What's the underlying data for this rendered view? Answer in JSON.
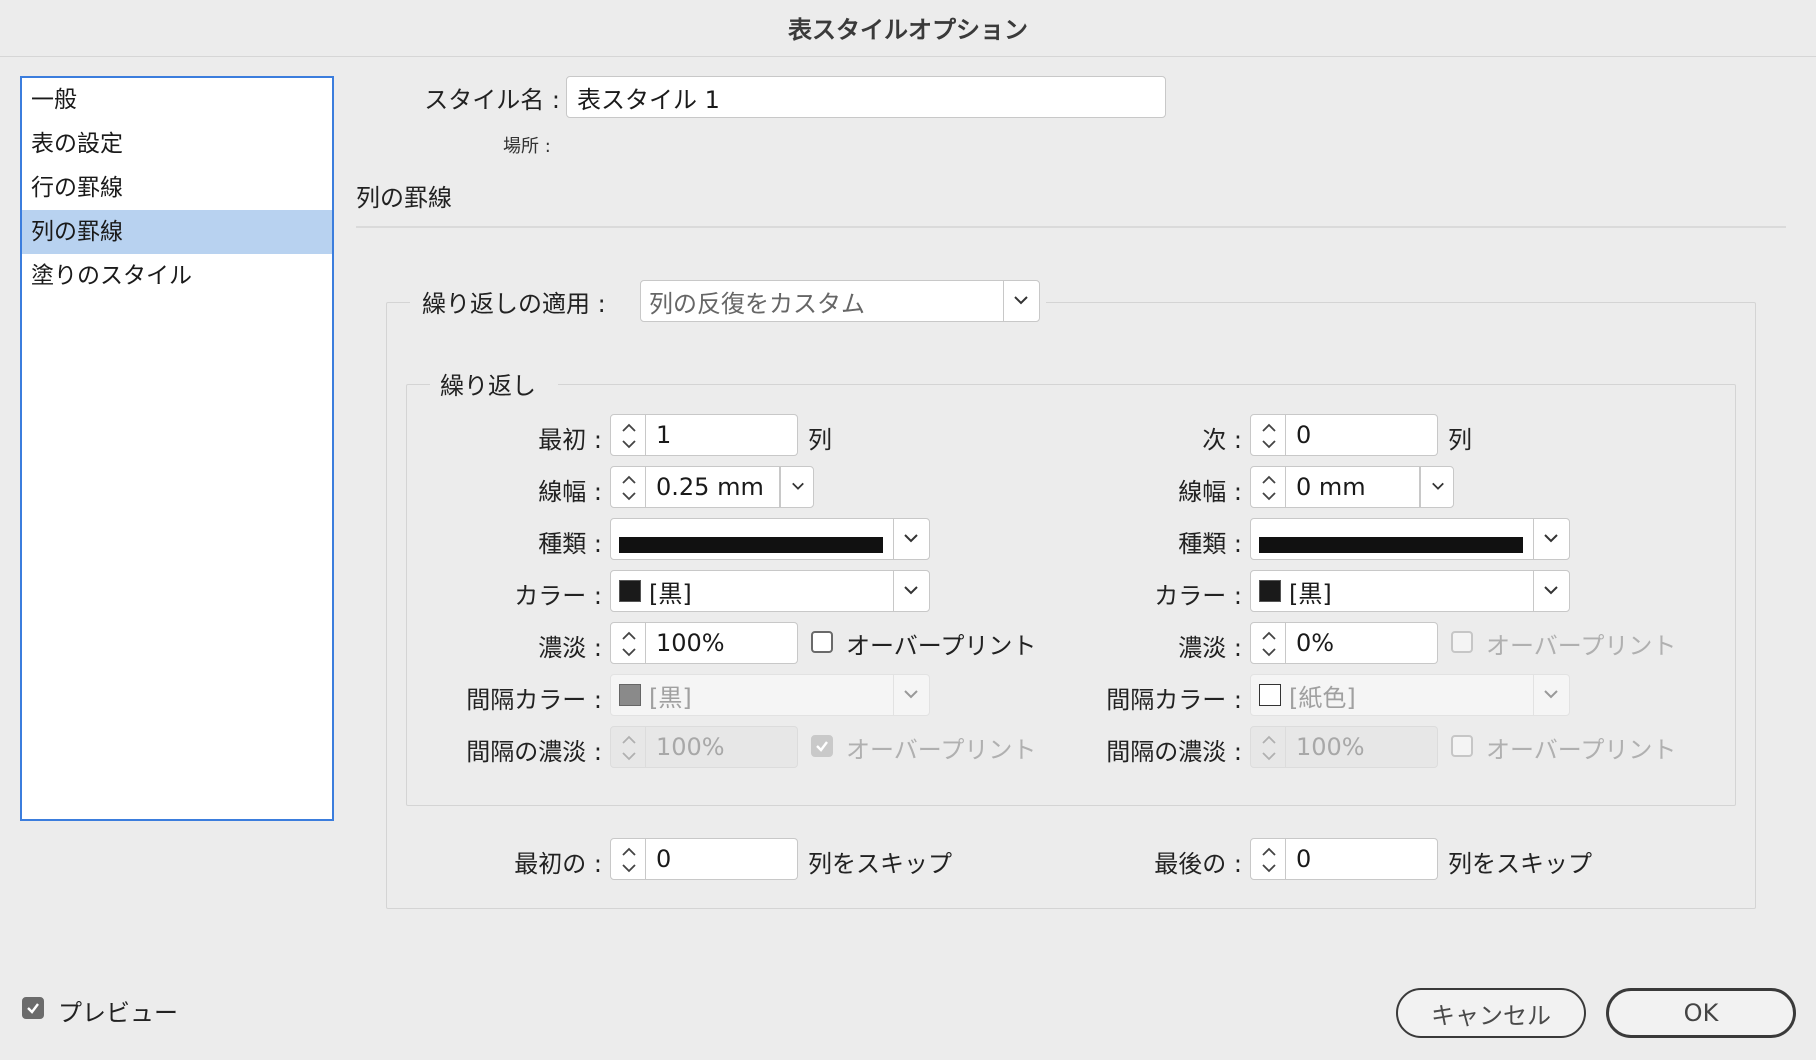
{
  "dialog": {
    "title": "表スタイルオプション"
  },
  "sidebar": {
    "items": [
      {
        "label": "一般",
        "selected": false
      },
      {
        "label": "表の設定",
        "selected": false
      },
      {
        "label": "行の罫線",
        "selected": false
      },
      {
        "label": "列の罫線",
        "selected": true
      },
      {
        "label": "塗りのスタイル",
        "selected": false
      }
    ]
  },
  "style_name": {
    "label": "スタイル名 :",
    "value": "表スタイル 1"
  },
  "location": {
    "label": "場所 :"
  },
  "section": {
    "title": "列の罫線"
  },
  "alternating": {
    "label": "繰り返しの適用 :",
    "value": "列の反復をカスタム"
  },
  "repeat": {
    "title": "繰り返し",
    "left": {
      "count_label": "最初 :",
      "count_value": "1",
      "count_unit": "列",
      "weight_label": "線幅 :",
      "weight_value": "0.25 mm",
      "type_label": "種類 :",
      "color_label": "カラー :",
      "color_value": "[黒]",
      "tint_label": "濃淡 :",
      "tint_value": "100%",
      "overprint_label": "オーバープリント",
      "overprint_checked": false,
      "gap_color_label": "間隔カラー :",
      "gap_color_value": "[黒]",
      "gap_tint_label": "間隔の濃淡 :",
      "gap_tint_value": "100%",
      "gap_overprint_label": "オーバープリント",
      "gap_overprint_checked": true
    },
    "right": {
      "count_label": "次 :",
      "count_value": "0",
      "count_unit": "列",
      "weight_label": "線幅 :",
      "weight_value": "0 mm",
      "type_label": "種類 :",
      "color_label": "カラー :",
      "color_value": "[黒]",
      "tint_label": "濃淡 :",
      "tint_value": "0%",
      "overprint_label": "オーバープリント",
      "overprint_checked": false,
      "gap_color_label": "間隔カラー :",
      "gap_color_value": "[紙色]",
      "gap_tint_label": "間隔の濃淡 :",
      "gap_tint_value": "100%",
      "gap_overprint_label": "オーバープリント",
      "gap_overprint_checked": false
    }
  },
  "skip": {
    "first_label": "最初の :",
    "first_value": "0",
    "first_unit": "列をスキップ",
    "last_label": "最後の :",
    "last_value": "0",
    "last_unit": "列をスキップ"
  },
  "preview": {
    "label": "プレビュー",
    "checked": true
  },
  "buttons": {
    "cancel": "キャンセル",
    "ok": "OK"
  },
  "colors": {
    "accent": "#3b7ddd",
    "selection": "#b8d2f0",
    "background": "#ececec"
  }
}
